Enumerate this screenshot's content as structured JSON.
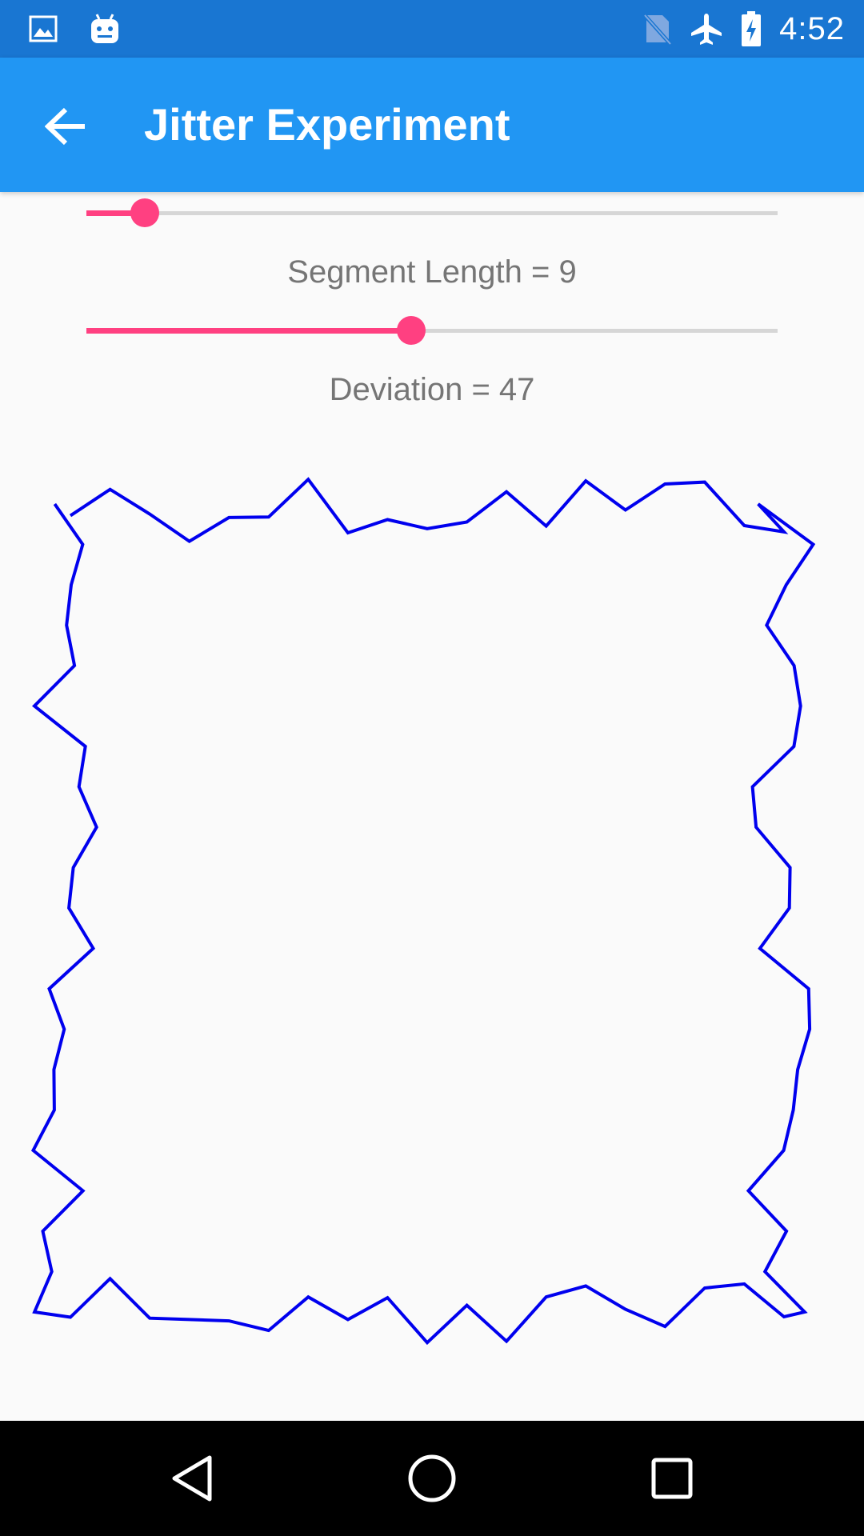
{
  "status_bar": {
    "time": "4:52",
    "left_icons": [
      "image-icon",
      "android-icon"
    ],
    "right_icons": [
      "no-sim-icon",
      "airplane-mode-icon",
      "battery-charging-icon"
    ]
  },
  "app_bar": {
    "title": "Jitter Experiment",
    "back_icon": "arrow-back-icon"
  },
  "controls": {
    "segment_length": {
      "label": "Segment Length = 9",
      "value": 9,
      "fraction": 0.085
    },
    "deviation": {
      "label": "Deviation = 47",
      "value": 47,
      "fraction": 0.47
    }
  },
  "jitter_path": {
    "stroke_color": "#0000EE",
    "segment_length": 9,
    "deviation": 47
  },
  "navigation_bar": {
    "buttons": [
      "back-triangle-icon",
      "home-circle-icon",
      "recents-square-icon"
    ]
  },
  "colors": {
    "status_bar": "#1976D2",
    "app_bar": "#2196F3",
    "accent": "#FF4081",
    "background": "#FAFAFA"
  }
}
